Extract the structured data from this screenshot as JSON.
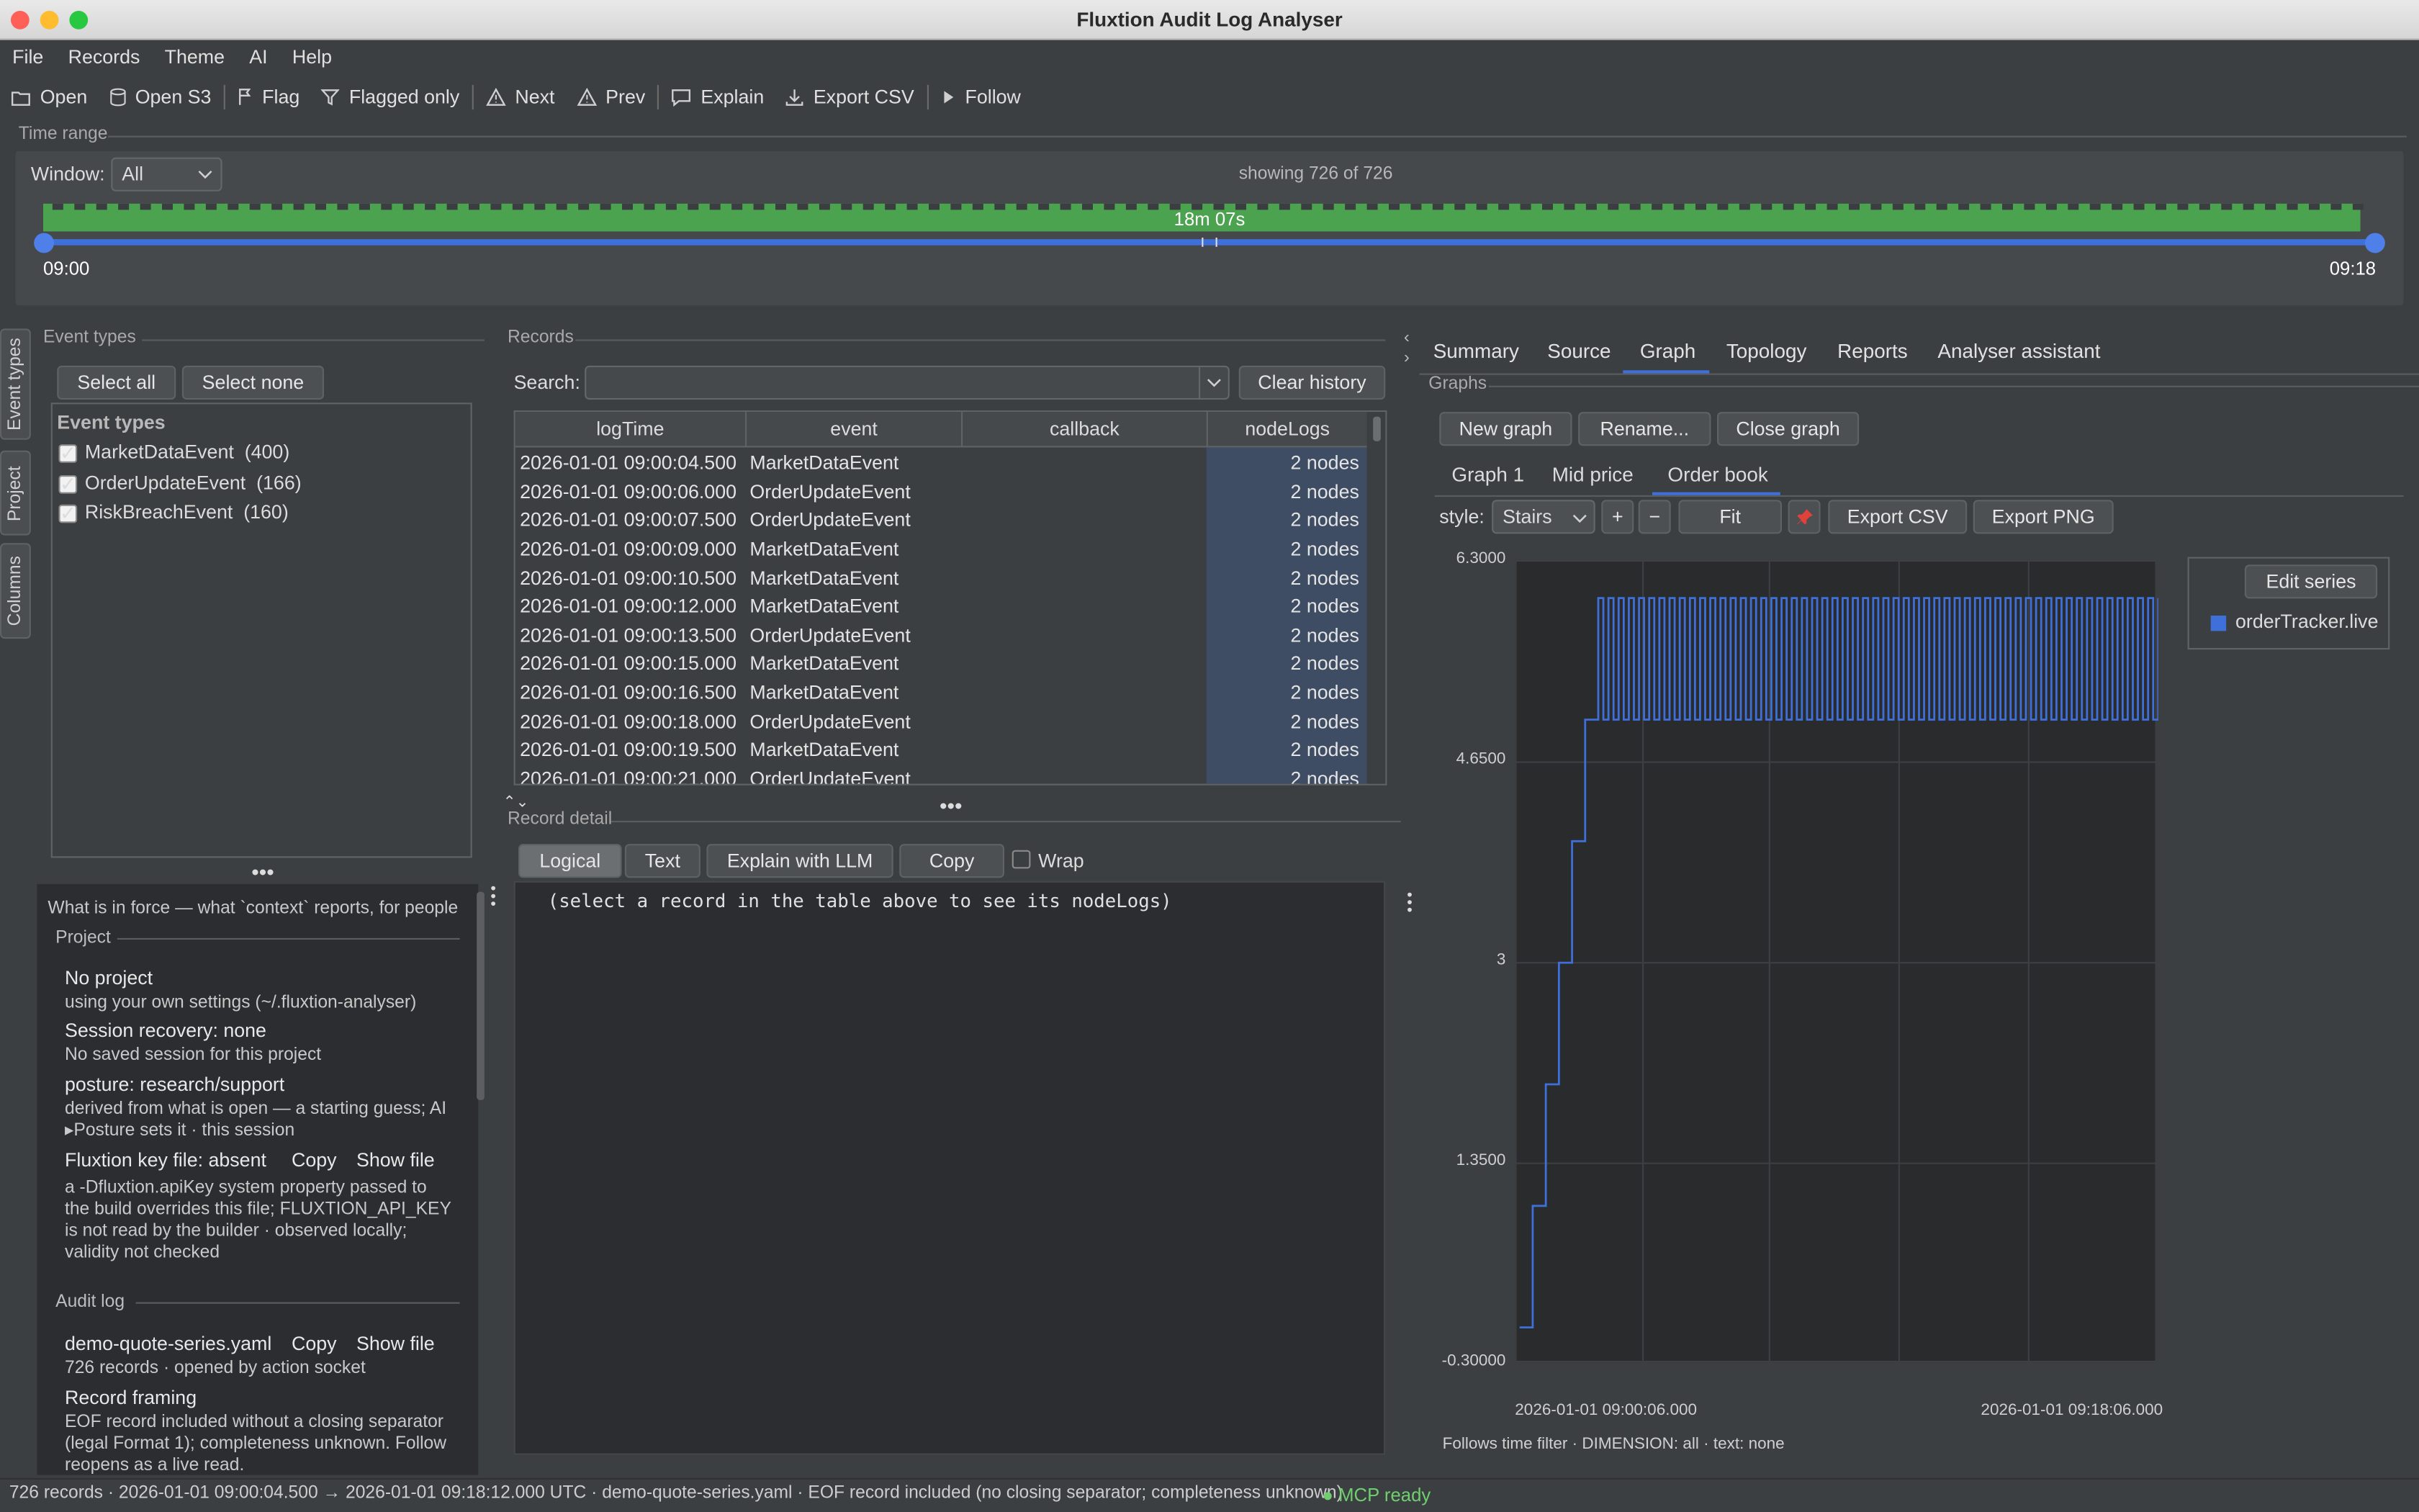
{
  "window": {
    "title": "Fluxtion Audit Log Analyser"
  },
  "menu": [
    "File",
    "Records",
    "Theme",
    "AI",
    "Help"
  ],
  "toolbar": {
    "open": "Open",
    "open_s3": "Open S3",
    "flag": "Flag",
    "flagged_only": "Flagged only",
    "next": "Next",
    "prev": "Prev",
    "explain": "Explain",
    "export_csv": "Export CSV",
    "follow": "Follow"
  },
  "time_range": {
    "label": "Time range",
    "window_label": "Window:",
    "window_value": "All",
    "showing": "showing 726 of 726",
    "duration": "18m 07s",
    "start": "09:00",
    "end": "09:18"
  },
  "side_tabs": [
    "Event types",
    "Project",
    "Columns"
  ],
  "event_types": {
    "section": "Event types",
    "select_all": "Select all",
    "select_none": "Select none",
    "list_header": "Event types",
    "items": [
      {
        "name": "MarketDataEvent",
        "count": "(400)",
        "checked": true
      },
      {
        "name": "OrderUpdateEvent",
        "count": "(166)",
        "checked": true
      },
      {
        "name": "RiskBreachEvent",
        "count": "(160)",
        "checked": true
      }
    ]
  },
  "context": {
    "intro": "What is in force — what `context` reports, for people",
    "project_section": "Project",
    "no_project": "No project",
    "no_project_sub": "using your own settings (~/.fluxtion-analyser)",
    "session": "Session recovery: none",
    "session_sub": "No saved session for this project",
    "posture": "posture: research/support",
    "posture_sub": "derived from what is open — a starting guess; AI",
    "posture_sub2": "Posture sets it · this session",
    "key_file": "Fluxtion key file: absent",
    "copy": "Copy",
    "show_file": "Show file",
    "key_desc": [
      "a -Dfluxtion.apiKey system property passed to",
      "the build overrides this file; FLUXTION_API_KEY",
      "is not read by the builder · observed locally;",
      "validity not checked"
    ],
    "audit_section": "Audit log",
    "audit_file": "demo-quote-series.yaml",
    "audit_sub": "726 records · opened by action socket",
    "framing": "Record framing",
    "framing_desc": [
      "EOF record included without a closing separator",
      "(legal Format 1); completeness unknown. Follow",
      "reopens as a live read."
    ]
  },
  "records": {
    "section": "Records",
    "search_label": "Search:",
    "search_value": "",
    "clear_history": "Clear history",
    "columns": [
      "logTime",
      "event",
      "callback",
      "nodeLogs"
    ],
    "rows": [
      [
        "2026-01-01 09:00:04.500",
        "MarketDataEvent",
        "",
        "2 nodes"
      ],
      [
        "2026-01-01 09:00:06.000",
        "OrderUpdateEvent",
        "",
        "2 nodes"
      ],
      [
        "2026-01-01 09:00:07.500",
        "OrderUpdateEvent",
        "",
        "2 nodes"
      ],
      [
        "2026-01-01 09:00:09.000",
        "MarketDataEvent",
        "",
        "2 nodes"
      ],
      [
        "2026-01-01 09:00:10.500",
        "MarketDataEvent",
        "",
        "2 nodes"
      ],
      [
        "2026-01-01 09:00:12.000",
        "MarketDataEvent",
        "",
        "2 nodes"
      ],
      [
        "2026-01-01 09:00:13.500",
        "OrderUpdateEvent",
        "",
        "2 nodes"
      ],
      [
        "2026-01-01 09:00:15.000",
        "MarketDataEvent",
        "",
        "2 nodes"
      ],
      [
        "2026-01-01 09:00:16.500",
        "MarketDataEvent",
        "",
        "2 nodes"
      ],
      [
        "2026-01-01 09:00:18.000",
        "OrderUpdateEvent",
        "",
        "2 nodes"
      ],
      [
        "2026-01-01 09:00:19.500",
        "MarketDataEvent",
        "",
        "2 nodes"
      ],
      [
        "2026-01-01 09:00:21.000",
        "OrderUpdateEvent",
        "",
        "2 nodes"
      ]
    ]
  },
  "detail": {
    "section": "Record detail",
    "logical": "Logical",
    "text": "Text",
    "explain_llm": "Explain with LLM",
    "copy": "Copy",
    "wrap": "Wrap",
    "placeholder": "(select a record in the table above to see its nodeLogs)"
  },
  "right_tabs": [
    "Summary",
    "Source",
    "Graph",
    "Topology",
    "Reports",
    "Analyser assistant"
  ],
  "graphs": {
    "section": "Graphs",
    "new_graph": "New graph",
    "rename": "Rename...",
    "close_graph": "Close graph",
    "graph_tabs": [
      "Graph 1",
      "Mid price",
      "Order book"
    ],
    "style_label": "style:",
    "style_value": "Stairs",
    "plus": "+",
    "minus": "−",
    "fit": "Fit",
    "export_csv": "Export CSV",
    "export_png": "Export PNG",
    "edit_series": "Edit series",
    "footer": "Follows time filter · DIMENSION: all · text: none"
  },
  "chart_data": {
    "type": "line",
    "series": [
      {
        "name": "orderTracker.live",
        "color": "#3f6fd9"
      }
    ],
    "yticks": [
      "6.3000",
      "4.6500",
      "3",
      "1.3500",
      "-0.30000"
    ],
    "ylim": [
      -0.3,
      6.3
    ],
    "xticks": [
      "2026-01-01 09:00:06.000",
      "2026-01-01 09:18:06.000"
    ],
    "step_levels": [
      0,
      1,
      2,
      3,
      4,
      5,
      6
    ],
    "oscillation": [
      5,
      6
    ],
    "grid": true,
    "legend": "top-right"
  },
  "status": {
    "text": "726 records · 2026-01-01 09:00:04.500 → 2026-01-01 09:18:12.000 UTC · demo-quote-series.yaml · EOF record included (no closing separator; completeness unknown)",
    "mcp": "● MCP ready"
  },
  "colors": {
    "accent": "#3f6fd9",
    "timeline": "#4ca34f",
    "mcp": "#6fcf6f"
  }
}
